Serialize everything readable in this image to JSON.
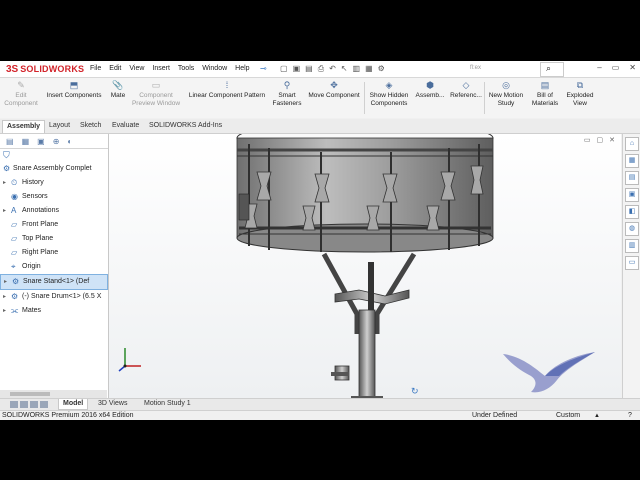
{
  "app": {
    "brand_prefix": "3S",
    "brand_name": "SOLIDWORKS",
    "document_title": "fl:ex"
  },
  "menu": [
    "File",
    "Edit",
    "View",
    "Insert",
    "Tools",
    "Window",
    "Help"
  ],
  "title_controls": {
    "minimize": "–",
    "restore": "▭",
    "close": "✕",
    "search_icon": "search-icon"
  },
  "commands": {
    "edit_component": "Edit Component",
    "insert_components": "Insert Components",
    "mate": "Mate",
    "component_preview": "Component Preview Window",
    "linear_pattern": "Linear Component Pattern",
    "smart_fasteners": "Smart Fasteners",
    "move_component": "Move Component",
    "show_hidden": "Show Hidden Components",
    "assembly_features": "Assemb...",
    "reference_geometry": "Referenc...",
    "new_motion_study": "New Motion Study",
    "bill_of_materials": "Bill of Materials",
    "exploded_view": "Exploded View"
  },
  "tabs": [
    "Assembly",
    "Layout",
    "Sketch",
    "Evaluate",
    "SOLIDWORKS Add-Ins"
  ],
  "tree": {
    "root": "Snare Assembly Complet",
    "items": [
      {
        "label": "History",
        "icon": "history-icon",
        "expand": "▸"
      },
      {
        "label": "Sensors",
        "icon": "sensor-icon",
        "expand": ""
      },
      {
        "label": "Annotations",
        "icon": "annotation-icon",
        "expand": "▸"
      },
      {
        "label": "Front Plane",
        "icon": "plane-icon",
        "expand": ""
      },
      {
        "label": "Top Plane",
        "icon": "plane-icon",
        "expand": ""
      },
      {
        "label": "Right Plane",
        "icon": "plane-icon",
        "expand": ""
      },
      {
        "label": "Origin",
        "icon": "origin-icon",
        "expand": ""
      },
      {
        "label": "Snare Stand<1> (Def",
        "icon": "subassembly-icon",
        "expand": "▸",
        "selected": true
      },
      {
        "label": "(-) Snare Drum<1> (6.5 X",
        "icon": "subassembly-icon",
        "expand": "▸"
      },
      {
        "label": "Mates",
        "icon": "mates-icon",
        "expand": "▸"
      }
    ]
  },
  "bottom_tabs": [
    "Model",
    "3D Views",
    "Motion Study 1"
  ],
  "status": {
    "edition": "SOLIDWORKS Premium 2016 x64 Edition",
    "definition": "Under Defined",
    "units": "Custom",
    "help": "?"
  },
  "colors": {
    "brand_red": "#d2232a",
    "selection_blue": "#cfe3f7",
    "icon_blue": "#3a6fb0",
    "drum_gray": "#9a9a9a"
  }
}
